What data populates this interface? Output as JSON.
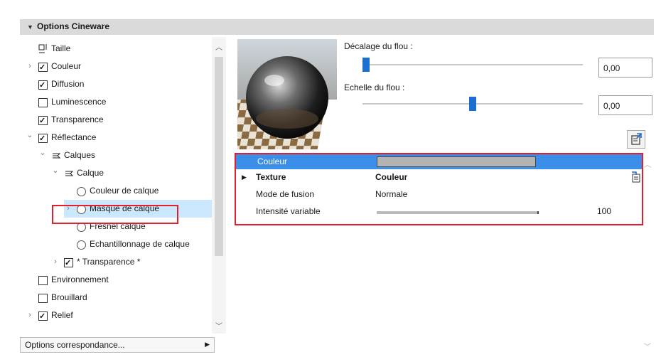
{
  "header": {
    "title": "Options Cineware"
  },
  "tree": {
    "items": [
      {
        "label": "Taille",
        "indent": 0,
        "kind": "size",
        "chevron": "",
        "checked": null
      },
      {
        "label": "Couleur",
        "indent": 0,
        "kind": "checkbox",
        "chevron": "right",
        "checked": true
      },
      {
        "label": "Diffusion",
        "indent": 0,
        "kind": "checkbox",
        "chevron": "",
        "checked": true
      },
      {
        "label": "Luminescence",
        "indent": 0,
        "kind": "checkbox",
        "chevron": "",
        "checked": false
      },
      {
        "label": "Transparence",
        "indent": 0,
        "kind": "checkbox",
        "chevron": "",
        "checked": true
      },
      {
        "label": "Réflectance",
        "indent": 0,
        "kind": "checkbox",
        "chevron": "down",
        "checked": true
      },
      {
        "label": "Calques",
        "indent": 1,
        "kind": "layers",
        "chevron": "down",
        "checked": null
      },
      {
        "label": "Calque",
        "indent": 2,
        "kind": "layers",
        "chevron": "down",
        "checked": null
      },
      {
        "label": "Couleur de calque",
        "indent": 3,
        "kind": "radio",
        "chevron": "",
        "checked": null
      },
      {
        "label": "Masque de calque",
        "indent": 3,
        "kind": "radio",
        "chevron": "right",
        "checked": null,
        "selected": true
      },
      {
        "label": "Fresnel calque",
        "indent": 3,
        "kind": "radio",
        "chevron": "",
        "checked": null
      },
      {
        "label": "Echantillonnage de calque",
        "indent": 3,
        "kind": "radio",
        "chevron": "",
        "checked": null
      },
      {
        "label": "* Transparence *",
        "indent": 2,
        "kind": "checkbox",
        "chevron": "right",
        "checked": true
      },
      {
        "label": "Environnement",
        "indent": 0,
        "kind": "checkbox",
        "chevron": "",
        "checked": false
      },
      {
        "label": "Brouillard",
        "indent": 0,
        "kind": "checkbox",
        "chevron": "",
        "checked": false
      },
      {
        "label": "Relief",
        "indent": 0,
        "kind": "checkbox",
        "chevron": "right",
        "checked": true
      }
    ]
  },
  "options_button": {
    "label": "Options correspondance..."
  },
  "blur": {
    "offset_label": "Décalage du flou :",
    "offset_value": "0,00",
    "offset_level": 0.0,
    "scale_label": "Echelle du flou :",
    "scale_value": "0,00",
    "scale_level": 0.5
  },
  "properties": {
    "rows": [
      {
        "name": "Couleur",
        "value": "",
        "type": "color",
        "selected": true
      },
      {
        "name": "Texture",
        "value": "Couleur",
        "type": "texture",
        "bold": true
      },
      {
        "name": "Mode de fusion",
        "value": "Normale",
        "type": "text"
      },
      {
        "name": "Intensité variable",
        "value": "100",
        "type": "slider",
        "level": 1.0
      }
    ]
  },
  "colors": {
    "accent": "#3c8fe8",
    "highlight": "#e0202b",
    "thumb": "#1a6fd0",
    "selection": "#cce8ff"
  }
}
